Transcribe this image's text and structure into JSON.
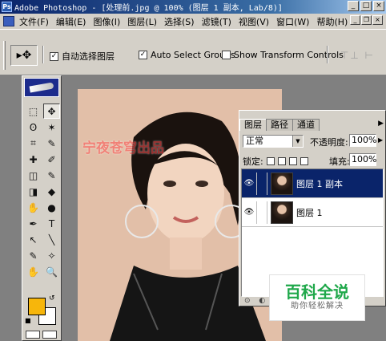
{
  "window": {
    "title": "Adobe Photoshop - [处理前.jpg @ 100% (图层 1 副本, Lab/8)]",
    "app_icon": "Ps",
    "min_label": "_",
    "max_label": "□",
    "close_label": "×"
  },
  "menubar": {
    "items": [
      "文件(F)",
      "编辑(E)",
      "图像(I)",
      "图层(L)",
      "选择(S)",
      "滤镜(T)",
      "视图(V)",
      "窗口(W)",
      "帮助(H)"
    ],
    "doc_min": "_",
    "doc_restore": "❐",
    "doc_close": "×"
  },
  "options_bar": {
    "tool_preset_icon": "▸✥",
    "auto_select_layer_label": "自动选择图层",
    "auto_select_layer_checked": true,
    "auto_select_groups_label": "Auto Select Groups",
    "auto_select_groups_checked": true,
    "show_transform_label": "Show Transform Controls",
    "show_transform_checked": false,
    "align_icons": "⊤⊥ ⊢"
  },
  "toolbox": {
    "tools": [
      "⬚",
      "✥",
      "ʘ",
      "✶",
      "⌗",
      "✎",
      "✚",
      "✐",
      "◫",
      "✎",
      "◨",
      "◆",
      "✋",
      "●",
      "✒",
      "T",
      "↖",
      "╲",
      "✎",
      "✧",
      "✋",
      "🔍"
    ],
    "active_tool_index": 1,
    "foreground_color": "#f7b60b",
    "background_color": "#ffffff",
    "swap_icon": "↺",
    "default_icon": "■"
  },
  "canvas": {
    "watermark": "宁夜苍穹出品"
  },
  "layers_panel": {
    "tabs": [
      "图层",
      "路径",
      "通道"
    ],
    "active_tab": 0,
    "menu_icon": "▶",
    "blend_mode": "正常",
    "opacity_label": "不透明度:",
    "opacity_value": "100%",
    "lock_label": "锁定:",
    "fill_label": "填充:",
    "fill_value": "100%",
    "layers": [
      {
        "name": "图层 1 副本",
        "selected": true,
        "visible": true
      },
      {
        "name": "图层 1",
        "selected": false,
        "visible": true
      }
    ],
    "bottom_icons": "⊙ ◐ ▭ ▢ 🗑"
  },
  "overlay_logo": {
    "title": "百科全说",
    "subtitle": "助你轻松解决"
  }
}
